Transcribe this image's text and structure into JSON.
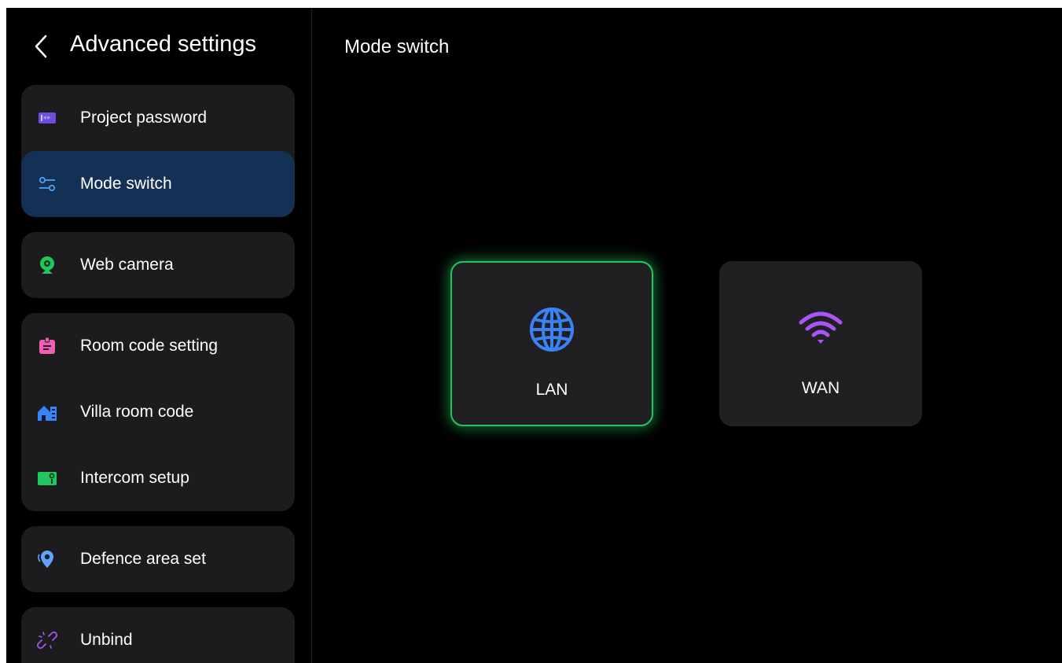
{
  "header": {
    "title": "Advanced settings",
    "back_icon": "chevron-left-icon"
  },
  "sidebar": {
    "items": [
      {
        "label": "Project password",
        "icon": "password-icon",
        "icon_color": "#6d4de0"
      },
      {
        "label": "Mode switch",
        "icon": "sliders-icon",
        "icon_color": "#4a9ff5",
        "active": true
      },
      {
        "label": "Web camera",
        "icon": "webcam-icon",
        "icon_color": "#22c55e"
      },
      {
        "label": "Room code setting",
        "icon": "room-code-icon",
        "icon_color": "#ec5fb4"
      },
      {
        "label": "Villa room code",
        "icon": "villa-icon",
        "icon_color": "#3b82f6"
      },
      {
        "label": "Intercom setup",
        "icon": "intercom-icon",
        "icon_color": "#22c55e"
      },
      {
        "label": "Defence area set",
        "icon": "location-pin-icon",
        "icon_color": "#60a5fa"
      },
      {
        "label": "Unbind",
        "icon": "unlink-icon",
        "icon_color": "#a855f7"
      }
    ]
  },
  "main": {
    "title": "Mode switch",
    "modes": [
      {
        "label": "LAN",
        "icon": "globe-icon",
        "icon_color": "#3b82f6",
        "selected": true
      },
      {
        "label": "WAN",
        "icon": "wifi-icon",
        "icon_color": "#a855f7",
        "selected": false
      }
    ]
  },
  "theme": {
    "background": "#000000",
    "card": "#1c1c1e",
    "active_item": "#143055",
    "selected_glow": "#22c55e"
  }
}
